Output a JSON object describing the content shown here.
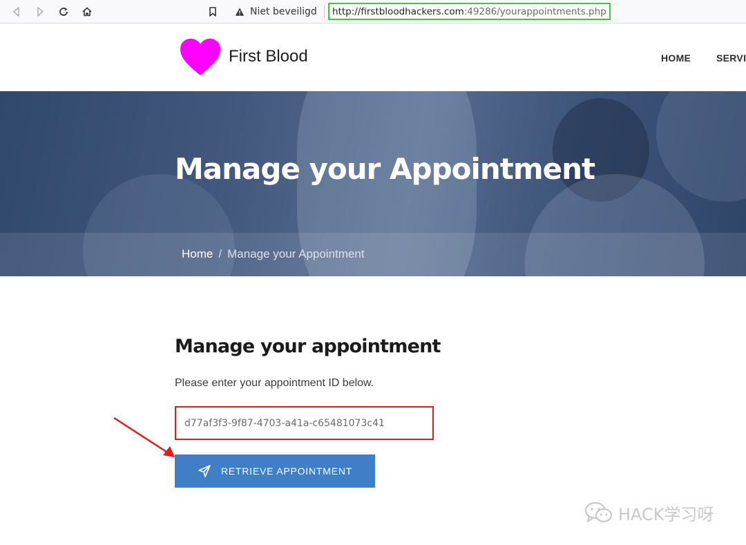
{
  "browser": {
    "security_label": "Niet beveiligd",
    "url_host": "http://firstbloodhackers.com",
    "url_rest": ":49286/yourappointments.php"
  },
  "header": {
    "site_name": "First Blood",
    "logo_color": "#ff00ff",
    "nav": [
      "HOME",
      "SERVIC"
    ]
  },
  "hero": {
    "title": "Manage your Appointment",
    "breadcrumb": {
      "home": "Home",
      "separator": "/",
      "current": "Manage your Appointment"
    }
  },
  "content": {
    "heading": "Manage your appointment",
    "intro": "Please enter your appointment ID below.",
    "appointment_id_value": "d77af3f3-9f87-4703-a41a-c65481073c41",
    "button_label": "RETRIEVE APPOINTMENT"
  },
  "watermark": {
    "text": "HACK学习呀"
  },
  "colors": {
    "button": "#3f7fc8",
    "input_highlight": "#e21b1b",
    "url_highlight": "#2fd12f",
    "arrow": "#e21b1b"
  }
}
